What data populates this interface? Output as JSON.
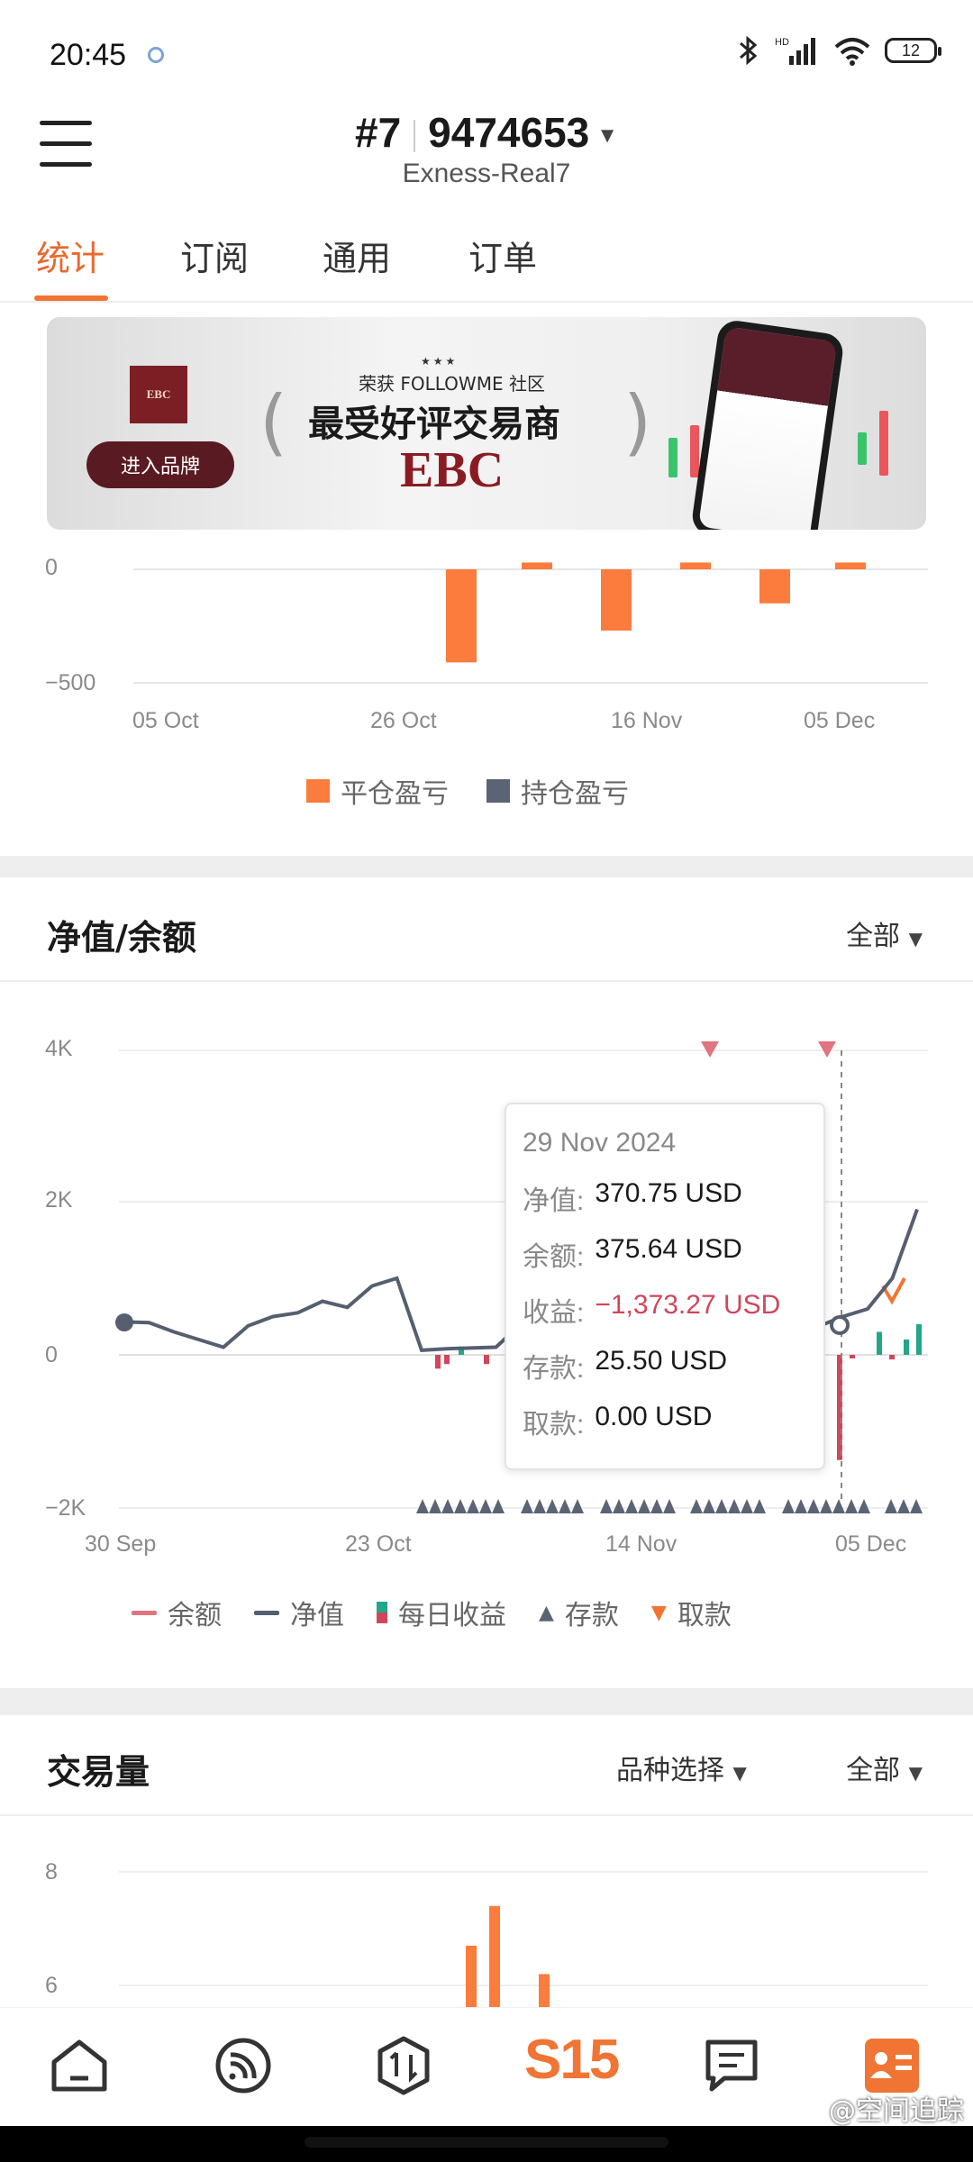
{
  "status_bar": {
    "time": "20:45",
    "battery": "12"
  },
  "header": {
    "account_prefix": "#7",
    "account_number": "9474653",
    "server": "Exness-Real7"
  },
  "tabs": [
    {
      "label": "统计",
      "active": true
    },
    {
      "label": "订阅",
      "active": false
    },
    {
      "label": "通用",
      "active": false
    },
    {
      "label": "订单",
      "active": false
    }
  ],
  "banner": {
    "button": "进入品牌",
    "subtitle": "荣获 FOLLOWME 社区",
    "title": "最受好评交易商",
    "brand": "EBC"
  },
  "pnl_chart": {
    "y_ticks": [
      "0",
      "−500"
    ],
    "x_ticks": [
      "05 Oct",
      "26 Oct",
      "16 Nov",
      "05 Dec"
    ],
    "legend": [
      "平仓盈亏",
      "持仓盈亏"
    ],
    "colors": {
      "closed": "#fb7c3c",
      "open": "#5b6475"
    }
  },
  "equity_section": {
    "title": "净值/余额",
    "filter": "全部"
  },
  "equity_chart": {
    "y_ticks": [
      "4K",
      "2K",
      "0",
      "−2K"
    ],
    "x_ticks": [
      "30 Sep",
      "23 Oct",
      "14 Nov",
      "05 Dec"
    ],
    "legend": [
      "余额",
      "净值",
      "每日收益",
      "存款",
      "取款"
    ],
    "colors": {
      "balance": "#e07480",
      "equity": "#555f70",
      "deposit": "#5b6475",
      "withdraw": "#f07534",
      "gain_pos": "#23a68a",
      "gain_neg": "#d0465a"
    }
  },
  "tooltip": {
    "date": "29 Nov 2024",
    "rows": [
      {
        "label": "净值:",
        "value": "370.75 USD"
      },
      {
        "label": "余额:",
        "value": "375.64 USD"
      },
      {
        "label": "收益:",
        "value": "−1,373.27 USD"
      },
      {
        "label": "存款:",
        "value": "25.50 USD"
      },
      {
        "label": "取款:",
        "value": "0.00 USD"
      }
    ]
  },
  "volume_section": {
    "title": "交易量",
    "filter_symbol": "品种选择",
    "filter_range": "全部",
    "y_ticks": [
      "8",
      "6"
    ]
  },
  "chart_data": [
    {
      "type": "bar",
      "ylim": [
        -600,
        50
      ],
      "series": [
        {
          "name": "平仓盈亏",
          "values": [
            -410,
            30,
            -270,
            30,
            -150,
            30
          ]
        }
      ],
      "x_tick_labels": [
        "05 Oct",
        "26 Oct",
        "16 Nov",
        "05 Dec"
      ]
    },
    {
      "type": "line",
      "ylim": [
        -2000,
        4000
      ],
      "x_tick_labels": [
        "30 Sep",
        "23 Oct",
        "14 Nov",
        "05 Dec"
      ],
      "series": [
        {
          "name": "净值",
          "values": [
            430,
            420,
            300,
            200,
            100,
            380,
            500,
            550,
            700,
            620,
            900,
            1000,
            60,
            80,
            90,
            100,
            400,
            420,
            460,
            480,
            520,
            600,
            700,
            800,
            900,
            1000,
            1100,
            1300,
            370,
            500,
            600,
            1000,
            1900
          ]
        }
      ]
    },
    {
      "type": "bar",
      "ylim": [
        5.5,
        8.5
      ],
      "values": [
        6.7,
        7.4,
        6.2
      ]
    }
  ],
  "watermark": "@空间追踪"
}
